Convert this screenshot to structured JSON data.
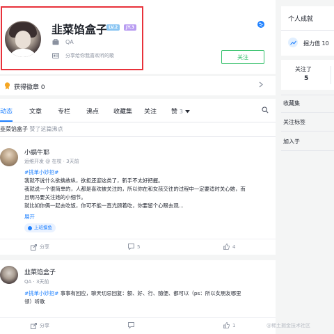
{
  "profile": {
    "name": "韭菜馅盒子",
    "level_badge": "LV.2",
    "jy_badge": "JY.3",
    "job": "QA",
    "bio": "分享给你我喜欢听的歌",
    "follow_label": "关注"
  },
  "badges": {
    "label": "获得徽章 0"
  },
  "tabs": [
    "动态",
    "文章",
    "专栏",
    "沸点",
    "收藏集",
    "关注",
    "赞"
  ],
  "tab_like_count": "3",
  "activity": {
    "user": "韭菜馅盒子",
    "text": "赞了这篇沸点"
  },
  "posts": [
    {
      "author": "小蜗牛耶",
      "meta": "运维开发 @ 在校 · 3天前",
      "tag": "#挑单小妙招#",
      "lines": [
        "我就不说什么欲擒故纵，欲拒还迎这类了，新手不太好把握。",
        "我就说一个很简单的，人都是喜欢被关注的，所以你在和女孩交往的过程中一定要适时关心她，而",
        "且明冯要关注她的小细节。",
        "就比如你俩一起去吃饭，你可不能一直光顾着吃，你要留个心眼去观..."
      ],
      "expand": "展开",
      "topic": "上班摸鱼",
      "actions": {
        "share": "分享",
        "comments": "5",
        "likes": "4"
      }
    },
    {
      "author": "韭菜馅盒子",
      "meta": "QA · 3天前",
      "tag": "#挑单小妙招#",
      "lines": [
        " 事事有回应，聊天切忌回复：额、好、行、随便、都可以（ps：所以女朋友哪里",
        "领）听歌"
      ],
      "actions": {
        "share": "分享",
        "comments": "",
        "likes": "1"
      }
    }
  ],
  "watermark": "@稀土掘金技术社区",
  "sidebar": {
    "achievements_title": "个人成就",
    "mining_label": "掘力值 10",
    "following_label": "关注了",
    "following_count": "5",
    "links": [
      "收藏集",
      "关注标签",
      "加入于"
    ]
  },
  "colors": {
    "accent": "#1e80ff",
    "follow_green": "#37c16d",
    "highlight_red": "#e8313a"
  }
}
